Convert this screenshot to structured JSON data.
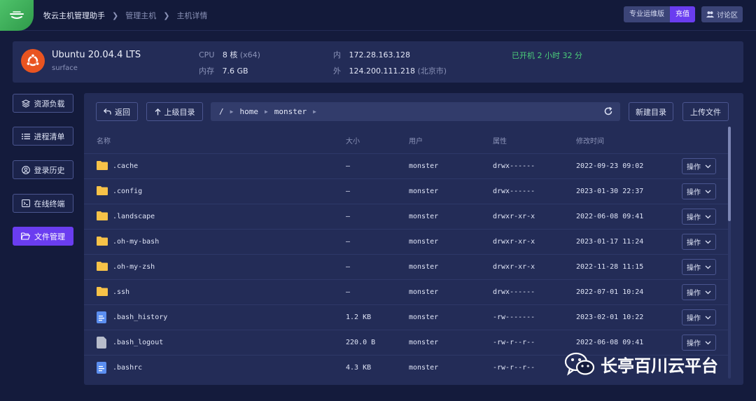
{
  "header": {
    "breadcrumbs": [
      "牧云主机管理助手",
      "管理主机",
      "主机详情"
    ],
    "plan_label": "专业运维版",
    "recharge_label": "充值",
    "forum_label": "讨论区"
  },
  "host": {
    "os_name": "Ubuntu 20.04.4 LTS",
    "hostname": "surface",
    "cpu_label": "CPU",
    "cpu_value": "8 核",
    "cpu_arch": "(x64)",
    "mem_label": "内存",
    "mem_value": "7.6 GB",
    "inner_label": "内",
    "inner_ip": "172.28.163.128",
    "outer_label": "外",
    "outer_ip": "124.200.111.218",
    "outer_loc": "(北京市)",
    "uptime": "已开机 2 小时 32 分"
  },
  "sidebar": {
    "items": [
      {
        "label": "资源负载"
      },
      {
        "label": "进程清单"
      },
      {
        "label": "登录历史"
      },
      {
        "label": "在线终端"
      },
      {
        "label": "文件管理"
      }
    ]
  },
  "files": {
    "back_label": "返回",
    "up_label": "上级目录",
    "path_root": "/",
    "path_segments": [
      "home",
      "monster"
    ],
    "new_dir_label": "新建目录",
    "upload_label": "上传文件",
    "columns": {
      "name": "名称",
      "size": "大小",
      "user": "用户",
      "perm": "属性",
      "mtime": "修改时间"
    },
    "op_label": "操作",
    "rows": [
      {
        "name": ".cache",
        "size": "–",
        "user": "monster",
        "perm": "drwx------",
        "mtime": "2022-09-23 09:02",
        "type": "folder"
      },
      {
        "name": ".config",
        "size": "–",
        "user": "monster",
        "perm": "drwx------",
        "mtime": "2023-01-30 22:37",
        "type": "folder"
      },
      {
        "name": ".landscape",
        "size": "–",
        "user": "monster",
        "perm": "drwxr-xr-x",
        "mtime": "2022-06-08 09:41",
        "type": "folder"
      },
      {
        "name": ".oh-my-bash",
        "size": "–",
        "user": "monster",
        "perm": "drwxr-xr-x",
        "mtime": "2023-01-17 11:24",
        "type": "folder"
      },
      {
        "name": ".oh-my-zsh",
        "size": "–",
        "user": "monster",
        "perm": "drwxr-xr-x",
        "mtime": "2022-11-28 11:15",
        "type": "folder"
      },
      {
        "name": ".ssh",
        "size": "–",
        "user": "monster",
        "perm": "drwx------",
        "mtime": "2022-07-01 10:24",
        "type": "folder"
      },
      {
        "name": ".bash_history",
        "size": "1.2 KB",
        "user": "monster",
        "perm": "-rw-------",
        "mtime": "2023-02-01 10:22",
        "type": "text"
      },
      {
        "name": ".bash_logout",
        "size": "220.0 B",
        "user": "monster",
        "perm": "-rw-r--r--",
        "mtime": "2022-06-08 09:41",
        "type": "blank"
      },
      {
        "name": ".bashrc",
        "size": "4.3 KB",
        "user": "monster",
        "perm": "-rw-r--r--",
        "mtime": "",
        "type": "text"
      }
    ]
  },
  "watermark": {
    "text": "长亭百川云平台"
  },
  "colors": {
    "accent": "#6a3df0",
    "uptime": "#4cd07a",
    "folder": "#f7c248",
    "file": "#5b8ef0"
  }
}
